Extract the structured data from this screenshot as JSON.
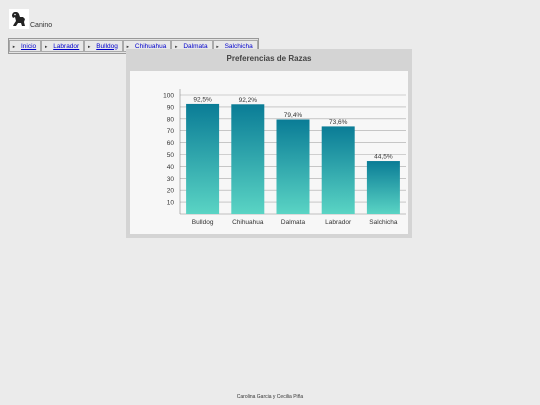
{
  "brand": {
    "name": "Canino",
    "logo_icon": "dog-logo-icon"
  },
  "nav": {
    "items": [
      {
        "label": "Inicio",
        "icon": "arrow-right-icon"
      },
      {
        "label": "Labrador",
        "icon": "arrow-right-icon"
      },
      {
        "label": "Bulldog",
        "icon": "arrow-right-icon"
      },
      {
        "label": "Chihuahua",
        "icon": "arrow-right-icon"
      },
      {
        "label": "Dalmata",
        "icon": "arrow-right-icon"
      },
      {
        "label": "Salchicha",
        "icon": "arrow-right-icon"
      }
    ]
  },
  "chart_data": {
    "type": "bar",
    "title": "Preferencias de Razas",
    "categories": [
      "Bulldog",
      "Chihuahua",
      "Dalmata",
      "Labrador",
      "Salchicha"
    ],
    "values": [
      92.5,
      92.2,
      79.4,
      73.6,
      44.5
    ],
    "value_labels": [
      "92,5%",
      "92,2%",
      "79,4%",
      "73,6%",
      "44,5%"
    ],
    "ylim": [
      0,
      100
    ],
    "yticks": [
      10,
      20,
      30,
      40,
      50,
      60,
      70,
      80,
      90,
      100
    ],
    "grid": true,
    "colors": {
      "bar_top": "#0a7c96",
      "bar_bottom": "#5ad4c4",
      "grid": "#a8a8a8"
    }
  },
  "footer": {
    "text": "Carolina Garcia y Cecilia Piña"
  }
}
